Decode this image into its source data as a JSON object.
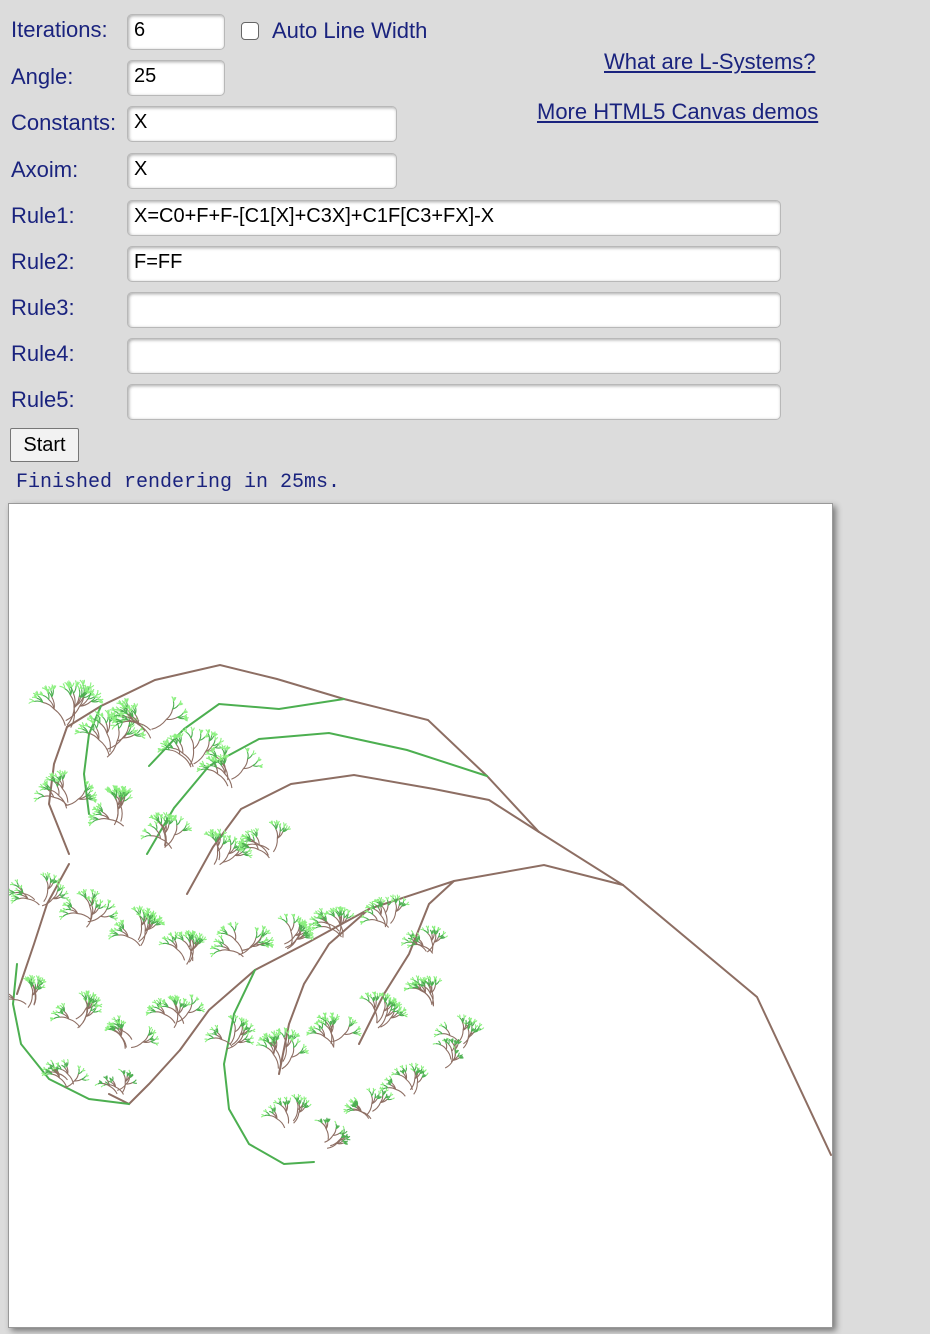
{
  "form": {
    "iterations": {
      "label": "Iterations:",
      "value": "6"
    },
    "auto_line_width": {
      "label": "Auto Line Width",
      "checked": false
    },
    "angle": {
      "label": "Angle:",
      "value": "25"
    },
    "constants": {
      "label": "Constants:",
      "value": "X"
    },
    "axiom": {
      "label": "Axoim:",
      "value": "X"
    },
    "rule1": {
      "label": "Rule1:",
      "value": "X=C0+F+F-[C1[X]+C3X]+C1F[C3+FX]-X"
    },
    "rule2": {
      "label": "Rule2:",
      "value": "F=FF"
    },
    "rule3": {
      "label": "Rule3:",
      "value": ""
    },
    "rule4": {
      "label": "Rule4:",
      "value": ""
    },
    "rule5": {
      "label": "Rule5:",
      "value": ""
    },
    "start_label": "Start"
  },
  "links": {
    "what_are": "What are L-Systems?",
    "more_demos": "More HTML5 Canvas demos"
  },
  "status": "Finished rendering in 25ms.",
  "colors": {
    "label_text": "#1a237e",
    "branch_brown": "#8d6e63",
    "branch_green": "#4caf50",
    "leaf_green": "#8bf07f"
  }
}
